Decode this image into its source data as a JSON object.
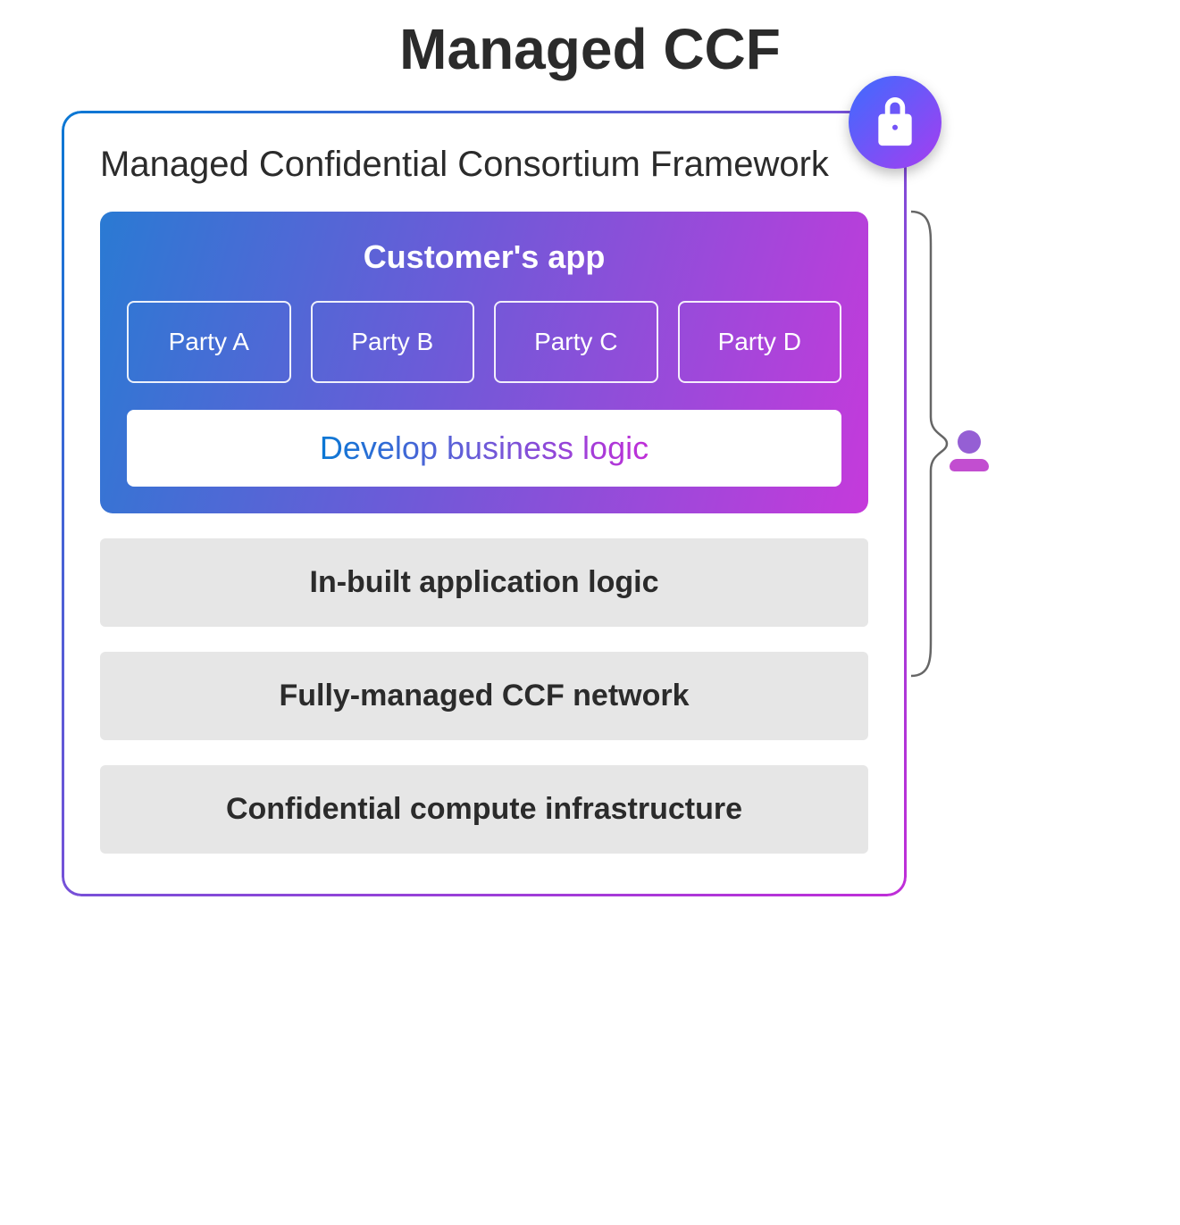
{
  "title": "Managed CCF",
  "frame": {
    "subtitle": "Managed Confidential Consortium Framework",
    "app": {
      "title": "Customer's app",
      "parties": [
        "Party A",
        "Party B",
        "Party C",
        "Party D"
      ],
      "develop": "Develop business logic"
    },
    "layers": [
      "In-built application logic",
      "Fully-managed CCF network",
      "Confidential compute infrastructure"
    ]
  },
  "icons": {
    "lock": "lock-icon",
    "user": "user-icon"
  }
}
